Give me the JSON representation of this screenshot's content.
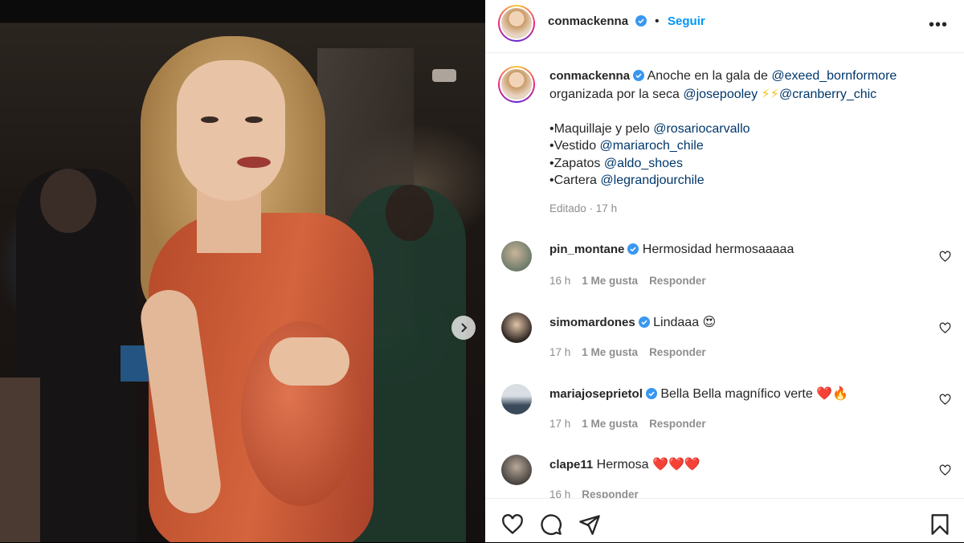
{
  "post": {
    "author": "conmackenna",
    "follow_label": "Seguir",
    "more_icon": "more-horizontal-icon",
    "next_icon": "chevron-right-icon"
  },
  "caption": {
    "username": "conmackenna",
    "text1": "Anoche en la gala de ",
    "mention1": "@exeed_bornformore",
    "text2": "organizada por la seca ",
    "mention2": "@josepooley",
    "emoji1": "⚡⚡",
    "mention3": "@cranberry_chic",
    "line1_label": "•Maquillaje y pelo ",
    "line1_mention": "@rosariocarvallo",
    "line2_label": "•Vestido ",
    "line2_mention": "@mariaroch_chile",
    "line3_label": "•Zapatos ",
    "line3_mention": "@aldo_shoes",
    "line4_label": "•Cartera ",
    "line4_mention": "@legrandjourchile",
    "edited": "Editado",
    "time": "17 h"
  },
  "comments": [
    {
      "username": "pin_montane",
      "text": "Hermosidad hermosaaaaa",
      "emoji": "",
      "time": "16 h",
      "likes": "1 Me gusta",
      "reply": "Responder",
      "verified": true
    },
    {
      "username": "simomardones",
      "text": "Lindaaa ",
      "emoji": "😍",
      "time": "17 h",
      "likes": "1 Me gusta",
      "reply": "Responder",
      "verified": true
    },
    {
      "username": "mariajoseprietol",
      "text": "Bella Bella magnífico verte ",
      "emoji": "❤️🔥",
      "time": "17 h",
      "likes": "1 Me gusta",
      "reply": "Responder",
      "verified": true
    },
    {
      "username": "clape11",
      "text": "Hermosa ",
      "emoji": "❤️❤️❤️",
      "time": "16 h",
      "likes": "",
      "reply": "Responder",
      "verified": false
    }
  ],
  "colors": {
    "accent": "#0095f6",
    "mention": "#00376b",
    "verified": "#3897f0",
    "muted": "#8e8e8e"
  },
  "actions": {
    "like_icon": "heart-icon",
    "comment_icon": "comment-icon",
    "share_icon": "send-icon",
    "save_icon": "bookmark-icon"
  }
}
